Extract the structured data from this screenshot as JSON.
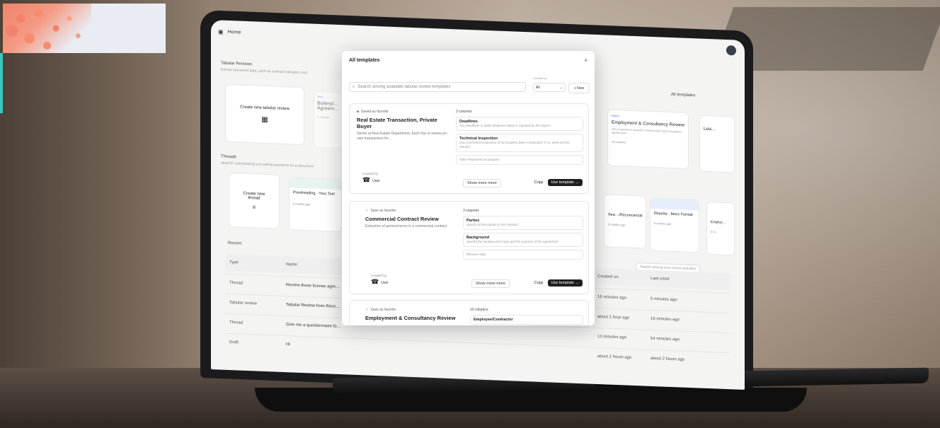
{
  "app": {
    "topbar_title": "Home",
    "sections": {
      "tabular_reviews": {
        "title": "Tabular Reviews",
        "subtitle": "Extract structured data, such as contract indicators and",
        "create_label": "Create new tabular review",
        "all_templates_label": "All templates"
      },
      "threads": {
        "title": "Threads",
        "subtitle": "Ideal for summarizing and asking questions for a document",
        "create_label": "Create new thread"
      },
      "recent": {
        "title": "Recent",
        "search_placeholder": "Search among your recent activities"
      }
    },
    "bg_cards": [
      {
        "tag": "New",
        "title": "Boilerpl… Agreem…",
        "meta": "2 columns"
      },
      {
        "tag": "Home",
        "title": "Employment & Consultancy Review",
        "desc": "Set of questions related to employment and consultancy agreements",
        "meta": "10 columns"
      },
      {
        "title": "Lea…"
      }
    ],
    "thread_cards": [
      {
        "title": "Proofreading - Your Text",
        "time": "8 months ago"
      },
      {
        "title": "Sea…/Reconcercial",
        "time": "8 months ago"
      },
      {
        "title": "Rewrite - More Formal",
        "time": "8 months ago"
      },
      {
        "title": "Employ…",
        "time": "8 m…"
      }
    ],
    "recent_headers": {
      "type": "Type",
      "name": "Name",
      "created_on": "Created on",
      "last_used": "Last used"
    },
    "recent_rows": [
      {
        "type": "Thread",
        "name": "Review these license agre…",
        "created": "16 minutes ago",
        "used": "5 minutes ago"
      },
      {
        "type": "Tabular review",
        "name": "Tabular Review from Rece…",
        "created": "about 1 hour ago",
        "used": "16 minutes ago"
      },
      {
        "type": "Thread",
        "name": "Give me a questionnaire fo…",
        "created": "13 minutes ago",
        "used": "54 minutes ago"
      },
      {
        "type": "Draft",
        "name": "Hi",
        "created": "about 2 hours ago",
        "used": "about 2 hours ago"
      }
    ]
  },
  "modal": {
    "title": "All templates",
    "close_icon": "×",
    "search_placeholder": "Search among available tabular review templates",
    "filter_label": "Created by",
    "filter_value": "All",
    "new_button": "+ New",
    "templates": [
      {
        "saved_label": "Saved as favorite",
        "name": "Real Estate Transaction, Private Buyer",
        "desc": "Senior at Real Estate Department. Each has to review pri-vate transactions for…",
        "created_by_label": "Created by",
        "creator": "User",
        "columns_label": "3 columns",
        "columns": [
          {
            "name": "Deadlines",
            "hint": "Any deadlines or dates whatever which is required by the buyer?"
          },
          {
            "name": "Technical Inspection",
            "hint": "Has a technical inspection of the property been conducted? If so, what are the results?"
          },
          {
            "name": "Other Payments on purpose",
            "hint": ""
          }
        ],
        "show_more": "Show more more",
        "copy": "Copy",
        "use": "Use template →"
      },
      {
        "saved_label": "Save as favorite",
        "name": "Commercial Contract Review",
        "desc": "Extraction of general terms in a commercial contract",
        "created_by_label": "Created by",
        "creator": "User",
        "columns_label": "3 columns",
        "columns": [
          {
            "name": "Parties",
            "hint": "Specify all the parties in the contract."
          },
          {
            "name": "Background",
            "hint": "Specify the background scope and the purpose of the agreement"
          },
          {
            "name": "Effective date",
            "hint": ""
          }
        ],
        "show_more": "Show more more",
        "copy": "Copy",
        "use": "Use template →"
      },
      {
        "saved_label": "Save as favorite",
        "name": "Employment & Consultancy Review",
        "columns_label": "10 columns",
        "columns": [
          {
            "name": "Employee/Contractor",
            "hint": ""
          }
        ]
      }
    ]
  }
}
